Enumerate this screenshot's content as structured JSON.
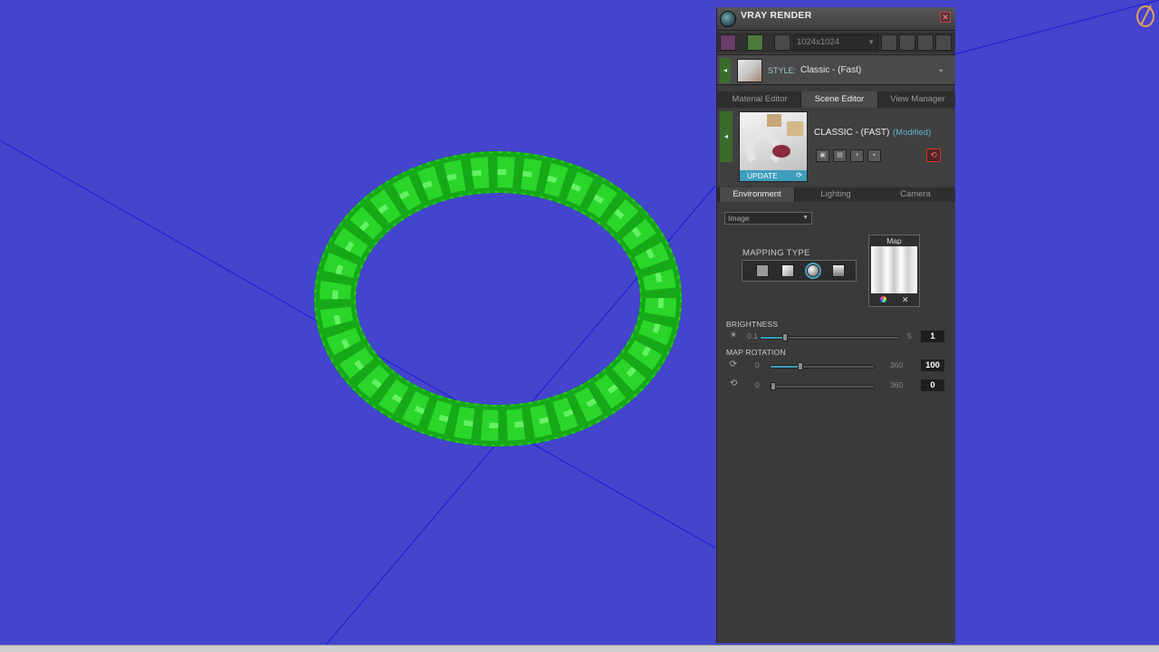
{
  "panel": {
    "title": "VRAY RENDER",
    "toolbar": {
      "resolution": "1024x1024"
    },
    "style": {
      "label": "STYLE:",
      "value": "Classic - (Fast)"
    },
    "editor_tabs": [
      {
        "label": "Material Editor"
      },
      {
        "label": "Scene Editor"
      },
      {
        "label": "View Manager"
      }
    ],
    "scene": {
      "name": "CLASSIC - (FAST)",
      "status": "(Modified)",
      "update_label": "UPDATE"
    },
    "env_tabs": [
      {
        "label": "Environment"
      },
      {
        "label": "Lighting"
      },
      {
        "label": "Camera"
      }
    ],
    "environment": {
      "source": "Image",
      "mapping_type_label": "MAPPING TYPE",
      "mapping_selected": "spherical",
      "map_label": "Map",
      "brightness": {
        "label": "BRIGHTNESS",
        "min": "0.1",
        "max": "5",
        "value": "1"
      },
      "map_rotation": {
        "label": "MAP ROTATION",
        "horizontal": {
          "min": "0",
          "max": "360",
          "value": "100"
        },
        "vertical": {
          "min": "0",
          "max": "360",
          "value": "0"
        }
      }
    }
  },
  "colors": {
    "viewport_bg": "#4444cc",
    "model_green": "#22cc22",
    "accent_blue": "#3d9dbd",
    "modified_text": "#5fb5cc"
  }
}
